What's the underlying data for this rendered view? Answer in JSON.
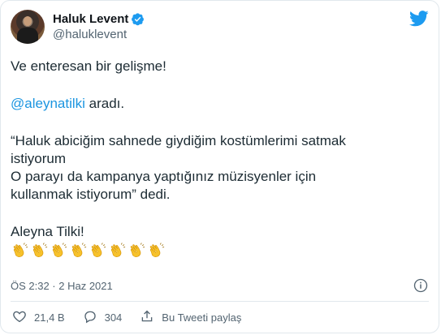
{
  "tweet": {
    "display_name": "Haluk Levent",
    "handle": "@haluklevent",
    "lines": {
      "intro": "Ve enteresan bir gelişme!",
      "mention": "@aleynatilki",
      "mention_suffix": " aradı.",
      "quote_line1": "“Haluk abiciğim sahnede giydiğim kostümlerimi satmak",
      "quote_line2": "istiyorum",
      "quote_line3": "O parayı da kampanya yaptığınız müzisyenler için",
      "quote_line4": "kullanmak istiyorum” dedi.",
      "closing": "Aleyna Tilki!"
    },
    "emoji": "clapping-hands",
    "emoji_count": 8,
    "timestamp": "ÖS 2:32 · 2 Haz 2021"
  },
  "actions": {
    "likes": "21,4 B",
    "replies": "304",
    "share_label": "Bu Tweeti paylaş"
  },
  "colors": {
    "accent": "#1d9bf0",
    "like": "#e0245e",
    "text": "#0f1419",
    "secondary": "#536471",
    "clap": "#f7c22b"
  },
  "icons": [
    "verified-badge-icon",
    "twitter-bird-icon",
    "info-icon",
    "heart-icon",
    "reply-icon",
    "share-icon",
    "clapping-hands-icon"
  ]
}
